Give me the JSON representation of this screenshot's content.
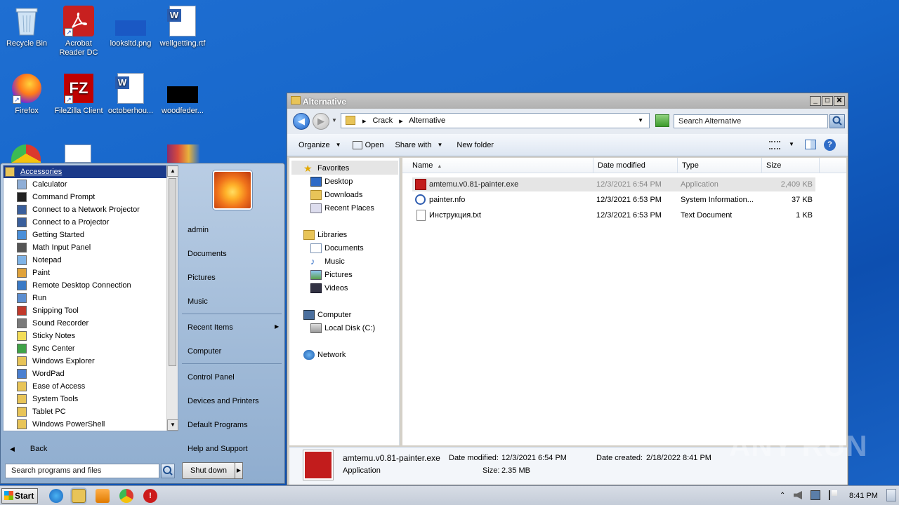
{
  "desktop": {
    "icons": [
      {
        "label": "Recycle Bin"
      },
      {
        "label": "Acrobat Reader DC"
      },
      {
        "label": "looksltd.png"
      },
      {
        "label": "wellgetting.rtf"
      },
      {
        "label": "Firefox"
      },
      {
        "label": "FileZilla Client"
      },
      {
        "label": "octoberhou..."
      },
      {
        "label": "woodfeder..."
      }
    ]
  },
  "start_menu": {
    "programs": [
      "Accessories",
      "Calculator",
      "Command Prompt",
      "Connect to a Network Projector",
      "Connect to a Projector",
      "Getting Started",
      "Math Input Panel",
      "Notepad",
      "Paint",
      "Remote Desktop Connection",
      "Run",
      "Snipping Tool",
      "Sound Recorder",
      "Sticky Notes",
      "Sync Center",
      "Windows Explorer",
      "WordPad",
      "Ease of Access",
      "System Tools",
      "Tablet PC",
      "Windows PowerShell"
    ],
    "back_label": "Back",
    "search_placeholder": "Search programs and files",
    "right": {
      "user": "admin",
      "documents": "Documents",
      "pictures": "Pictures",
      "music": "Music",
      "recent_items": "Recent Items",
      "computer": "Computer",
      "control_panel": "Control Panel",
      "devices_printers": "Devices and Printers",
      "default_programs": "Default Programs",
      "help_support": "Help and Support"
    },
    "shutdown_label": "Shut down"
  },
  "explorer": {
    "title": "Alternative",
    "breadcrumb": [
      "Crack",
      "Alternative"
    ],
    "search_placeholder": "Search Alternative",
    "toolbar": {
      "organize": "Organize",
      "open": "Open",
      "share_with": "Share with",
      "new_folder": "New folder"
    },
    "nav": {
      "favorites": "Favorites",
      "desktop": "Desktop",
      "downloads": "Downloads",
      "recent_places": "Recent Places",
      "libraries": "Libraries",
      "documents": "Documents",
      "music": "Music",
      "pictures": "Pictures",
      "videos": "Videos",
      "computer": "Computer",
      "local_disk": "Local Disk (C:)",
      "network": "Network"
    },
    "columns": {
      "name": "Name",
      "date_modified": "Date modified",
      "type": "Type",
      "size": "Size"
    },
    "files": [
      {
        "name": "amtemu.v0.81-painter.exe",
        "date": "12/3/2021 6:54 PM",
        "type": "Application",
        "size": "2,409 KB"
      },
      {
        "name": "painter.nfo",
        "date": "12/3/2021 6:53 PM",
        "type": "System Information...",
        "size": "37 KB"
      },
      {
        "name": "Инструкция.txt",
        "date": "12/3/2021 6:53 PM",
        "type": "Text Document",
        "size": "1 KB"
      }
    ],
    "details": {
      "filename": "amtemu.v0.81-painter.exe",
      "kind": "Application",
      "date_modified_label": "Date modified:",
      "date_modified": "12/3/2021 6:54 PM",
      "size_label": "Size:",
      "size": "2.35 MB",
      "date_created_label": "Date created:",
      "date_created": "2/18/2022 8:41 PM"
    }
  },
  "taskbar": {
    "start_label": "Start",
    "clock": "8:41 PM"
  },
  "watermark": "ANY RUN"
}
